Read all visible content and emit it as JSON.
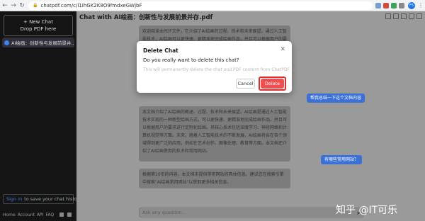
{
  "browser": {
    "url": "chatpdf.com/c/l1IhGK2K8O9fmdxeGWjbF",
    "profile_initials": "F5"
  },
  "sidebar": {
    "new_chat_label": "+ New Chat",
    "drop_pdf_label": "Drop PDF here",
    "chats": [
      {
        "label": "AI绘画：创新性与发展前景并..."
      }
    ],
    "signin_link": "Sign in",
    "signin_text": "to save your chat history",
    "footer_links": [
      "Home",
      "Account",
      "API",
      "FAQ"
    ]
  },
  "main": {
    "title": "Chat with AI绘画：创新性与发展前景并存.pdf",
    "messages": [
      {
        "role": "bot",
        "text": "欢迎阅读本PDF文件，它介绍了AI绘画的过程、技术和未来展望。通过人工智能技术，AI绘画可以更快速、更精准地完成绘画作品，并且可以根据用户的要求进行"
      },
      {
        "role": "user",
        "text": "帮我总结一下这个文档内容"
      },
      {
        "role": "bot",
        "text": "本文档介绍了AI绘画的概述、过程、技术和未来展望。AI绘画是通过人工智能技术实现的一种新型绘画方式，可以更快速、更精准地完成绘画作品，并且可以根据用户的要求进行定制化绘画。其核心技术包括深度学习、神经网络和计算机视觉等方面。未来，随着人工智能技术的不断发展，AI绘画将会在各个领域得到更广泛的应用，例如在艺术创作、图像处理、教育等方面。本文档还介绍了AI绘画使用的技术和常用网站。"
      },
      {
        "role": "user",
        "text": "有哪些常用网站？"
      },
      {
        "role": "bot",
        "text": "根据第10页的内容，本文档未提供常用网站的具体信息。建议您在搜索引擎中搜索\"AI绘画常用网站\"以获取更多相关信息。"
      }
    ],
    "input_placeholder": "Ask any question..."
  },
  "modal": {
    "title": "Delete Chat",
    "question": "Do you really want to delete this chat?",
    "description": "This will permanently delete the chat and PDF content from ChatPDF.",
    "cancel_label": "Cancel",
    "delete_label": "Delete"
  },
  "watermark": "知乎 @IT可乐"
}
